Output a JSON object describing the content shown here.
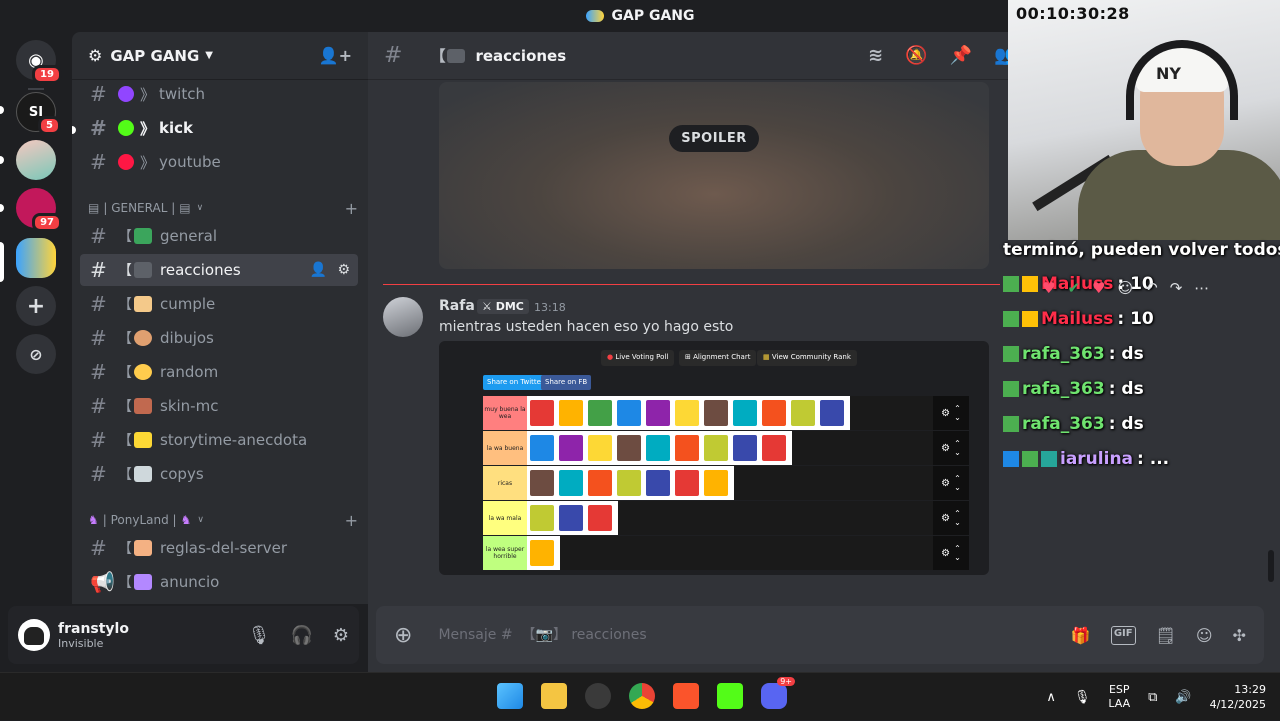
{
  "window": {
    "title": "GAP GANG"
  },
  "rail": {
    "badges": [
      "19",
      "5",
      "97"
    ]
  },
  "server": {
    "name": "GAP GANG"
  },
  "sidebar": {
    "channels_top": [
      {
        "name": "twitch",
        "prefix": "》"
      },
      {
        "name": "kick",
        "prefix": "》"
      },
      {
        "name": "youtube",
        "prefix": "》"
      }
    ],
    "category_general": "| GENERAL |",
    "channels_general": [
      {
        "name": "general",
        "bracket": "【"
      },
      {
        "name": "reacciones",
        "bracket": "【"
      },
      {
        "name": "cumple",
        "bracket": "【"
      },
      {
        "name": "dibujos",
        "bracket": "【"
      },
      {
        "name": "random",
        "bracket": "【"
      },
      {
        "name": "skin-mc",
        "bracket": "【"
      },
      {
        "name": "storytime-anecdota",
        "bracket": "【"
      },
      {
        "name": "copys",
        "bracket": "【"
      }
    ],
    "category_ponyland": "| PonyLand |",
    "channels_ponyland": [
      {
        "name": "reglas-del-server",
        "bracket": "【"
      },
      {
        "name": "anuncio",
        "bracket": "【"
      }
    ]
  },
  "user": {
    "name": "franstylo",
    "status": "Invisible"
  },
  "channel_header": {
    "bracket": "【",
    "name": "reacciones"
  },
  "spoiler": {
    "label": "SPOILER"
  },
  "message": {
    "author": "Rafa",
    "tag": "DMC",
    "time": "13:18",
    "text": "mientras usteden hacen eso yo hago esto"
  },
  "tierlist": {
    "top_buttons": [
      "Live Voting Poll",
      "Alignment Chart",
      "View Community Rank"
    ],
    "share_buttons": [
      "Share on Twitter",
      "Share on FB"
    ],
    "tiers": [
      {
        "label": "muy buena la wea",
        "color": "#ff7f7f",
        "items": 11
      },
      {
        "label": "la wa buena",
        "color": "#ffbf7f",
        "items": 9
      },
      {
        "label": "ricas",
        "color": "#ffdf7f",
        "items": 7
      },
      {
        "label": "la wa mala",
        "color": "#ffff7f",
        "items": 3
      },
      {
        "label": "la wea super horrible",
        "color": "#bfff7f",
        "items": 1
      }
    ]
  },
  "composer": {
    "placeholder": "Mensaje #  【📷】 reacciones"
  },
  "stream": {
    "timer": "00:10:30:28",
    "chat": [
      {
        "name": "",
        "text": "terminó, pueden volver todos"
      },
      {
        "name": "Mailuss",
        "text": ": 10"
      },
      {
        "name": "Mailuss",
        "text": ": 10"
      },
      {
        "name": "rafa_363",
        "text": ": ds"
      },
      {
        "name": "rafa_363",
        "text": ": ds"
      },
      {
        "name": "rafa_363",
        "text": ": ds"
      },
      {
        "name": "iarulina",
        "text": ": ..."
      }
    ]
  },
  "taskbar": {
    "lang1": "ESP",
    "lang2": "LAA",
    "time": "13:29",
    "date": "4/12/2025",
    "discord_badge": "9+"
  },
  "colors": {
    "accent_red": "#f23f43",
    "bg_main": "#313338",
    "bg_sidebar": "#2b2d31"
  }
}
